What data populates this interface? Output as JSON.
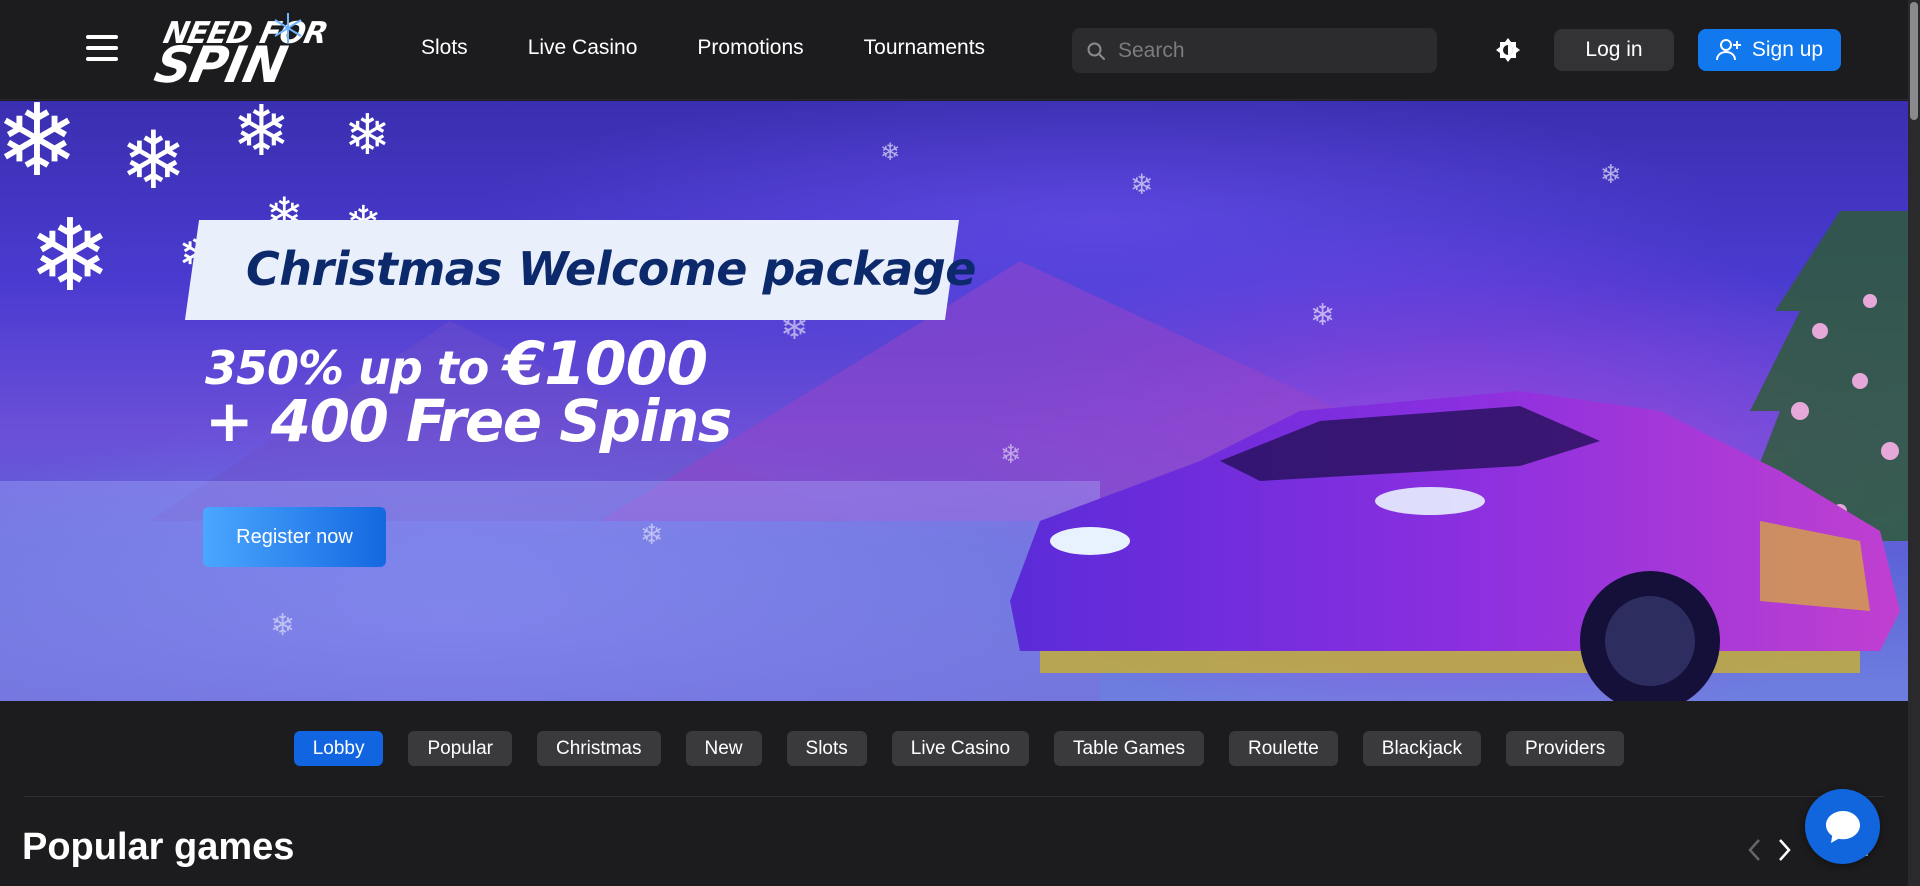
{
  "header": {
    "logo": {
      "line1": "NEED FOR",
      "line2": "SPIN"
    },
    "nav": [
      {
        "label": "Slots"
      },
      {
        "label": "Live Casino"
      },
      {
        "label": "Promotions"
      },
      {
        "label": "Tournaments"
      }
    ],
    "search": {
      "placeholder": "Search",
      "value": ""
    },
    "login_label": "Log in",
    "signup_label": "Sign up",
    "icons": {
      "menu": "hamburger-icon",
      "search": "search-icon",
      "theme": "theme-toggle-icon",
      "signup": "add-user-icon"
    }
  },
  "hero": {
    "title": "Christmas Welcome package",
    "line1_prefix": "350% up to ",
    "line1_amount": "€1000",
    "line2": "+ 400 Free Spins",
    "cta_label": "Register now"
  },
  "categories": [
    {
      "label": "Lobby",
      "active": true
    },
    {
      "label": "Popular",
      "active": false
    },
    {
      "label": "Christmas",
      "active": false
    },
    {
      "label": "New",
      "active": false
    },
    {
      "label": "Slots",
      "active": false
    },
    {
      "label": "Live Casino",
      "active": false
    },
    {
      "label": "Table Games",
      "active": false
    },
    {
      "label": "Roulette",
      "active": false
    },
    {
      "label": "Blackjack",
      "active": false
    },
    {
      "label": "Providers",
      "active": false
    }
  ],
  "popular": {
    "title": "Popular games",
    "view_all_label": "all"
  },
  "colors": {
    "brand_blue": "#1178ee",
    "active_tab": "#1165e0",
    "background": "#1c1c1e",
    "promo_title": "#0c2a6b"
  }
}
